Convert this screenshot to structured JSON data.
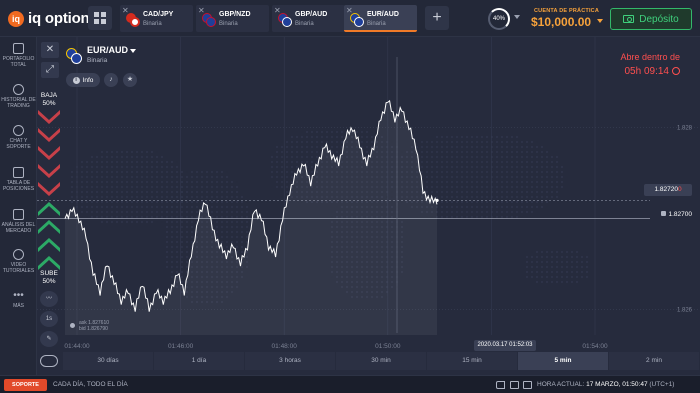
{
  "brand": {
    "logo_mark": "iq",
    "name": "iq option"
  },
  "tabs": [
    {
      "pair": "CAD/JPY",
      "type": "Binaria",
      "flag1": "#d52b1e",
      "flag2": "#ffffff",
      "active": false
    },
    {
      "pair": "GBP/NZD",
      "type": "Binaria",
      "flag1": "#1f3f9a",
      "flag2": "#1f3f9a",
      "active": false
    },
    {
      "pair": "GBP/AUD",
      "type": "Binaria",
      "flag1": "#1f3f9a",
      "flag2": "#1f3f9a",
      "active": false
    },
    {
      "pair": "EUR/AUD",
      "type": "Binaria",
      "flag1": "#1f3f9a",
      "flag2": "#1f3f9a",
      "active": true
    }
  ],
  "tabs_add": "+",
  "leverage_pct": "40%",
  "account": {
    "label": "CUENTA DE PRÁCTICA",
    "amount": "$10,000.00"
  },
  "deposit_label": "Depósito",
  "sidebar": [
    {
      "label": "PORTAFOLIO TOTAL",
      "icon": "briefcase-icon"
    },
    {
      "label": "HISTORIAL DE TRADING",
      "icon": "history-icon"
    },
    {
      "label": "CHAT Y SOPORTE",
      "icon": "chat-icon"
    },
    {
      "label": "TABLA DE POSICIONES",
      "icon": "leaderboard-icon"
    },
    {
      "label": "ANÁLISIS DEL MERCADO",
      "icon": "market-analysis-icon"
    },
    {
      "label": "VIDEO TUTORIALES",
      "icon": "play-icon"
    },
    {
      "label": "MÁS",
      "icon": "more-icon"
    }
  ],
  "asset": {
    "name": "EUR/AUD",
    "type": "Binaria",
    "info_label": "Info"
  },
  "expiry": {
    "label": "Abre dentro de",
    "time": "05h 09:14"
  },
  "updown": {
    "down_label": "BAJA",
    "down_pct": "50%",
    "up_label": "SUBE",
    "up_pct": "50%"
  },
  "timeframe_label": "1s",
  "ask_bid": {
    "ask": "ask 1.827610",
    "bid": "bid 1.826790"
  },
  "current_price": {
    "main": "1.82720",
    "highlight": "0"
  },
  "strike_price": "1.82700",
  "current_time_box": "2020.03.17 01:52:03",
  "periods": [
    "30 días",
    "1 día",
    "3 horas",
    "30 min",
    "15 min",
    "5 min",
    "2 min"
  ],
  "active_period": "5 min",
  "footer": {
    "support": "SOPORTE",
    "tagline": "CADA DÍA, TODO EL DÍA",
    "time_label": "HORA ACTUAL:",
    "time_value": "17 MARZO, 01:50:47",
    "tz": "(UTC+1)"
  },
  "chart_data": {
    "type": "line",
    "x_ticks": [
      "01:44:00",
      "01:46:00",
      "01:48:00",
      "01:50:00",
      "01:52:00",
      "01:54:00"
    ],
    "y_ticks": [
      "1.828",
      "1.826"
    ],
    "ylim": [
      1.8257,
      1.8285
    ],
    "series": [
      {
        "values": [
          1.827,
          1.8271,
          1.827,
          1.8268,
          1.8264,
          1.8262,
          1.8265,
          1.8263,
          1.8261,
          1.8262,
          1.826,
          1.8263,
          1.826,
          1.8262,
          1.8261,
          1.8262,
          1.8264,
          1.8262,
          1.8266,
          1.827,
          1.8272,
          1.8269,
          1.8267,
          1.8266,
          1.8267,
          1.8265,
          1.8267,
          1.8271,
          1.827,
          1.8267,
          1.8266,
          1.827,
          1.8273,
          1.8275,
          1.8276,
          1.8274,
          1.8276,
          1.8278,
          1.8277,
          1.8276,
          1.8279,
          1.828,
          1.8278,
          1.8276,
          1.8278,
          1.8281,
          1.8283,
          1.8281,
          1.8282,
          1.828,
          1.8278,
          1.8273,
          1.8272,
          1.8272
        ]
      }
    ],
    "reference_lines": {
      "current_price": 1.8272,
      "strike": 1.827
    },
    "grid": true,
    "background": "world-map"
  },
  "colors": {
    "accent": "#f07a28",
    "balance": "#f7a23b",
    "deposit": "#3fd07c",
    "down": "#d9434a",
    "up": "#2db86a",
    "alert": "#ff4f4f"
  }
}
